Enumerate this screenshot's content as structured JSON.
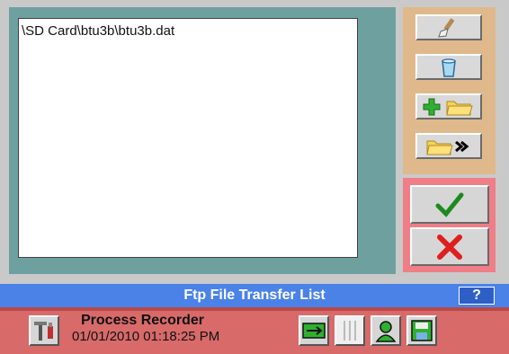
{
  "file_list": {
    "items": [
      "\\SD Card\\btu3b\\btu3b.dat"
    ]
  },
  "tools": [
    {
      "name": "clear",
      "icon": "brush-icon"
    },
    {
      "name": "delete",
      "icon": "trash-can-icon"
    },
    {
      "name": "add",
      "icon": "add-folder-icon"
    },
    {
      "name": "transfer",
      "icon": "folder-forward-icon"
    }
  ],
  "actions": {
    "ok_icon": "checkmark-icon",
    "cancel_icon": "close-icon"
  },
  "title_bar": {
    "title": "Ftp File Transfer List",
    "help_label": "?"
  },
  "status": {
    "recorder_name": "Process Recorder",
    "datetime": "01/01/2010 01:18:25 PM"
  },
  "colors": {
    "list_frame": "#6fa0a0",
    "tool_panel": "#dfb98b",
    "action_panel": "#ef7e86",
    "title_bar": "#4a82e8",
    "status_bar": "#d86a6a"
  }
}
